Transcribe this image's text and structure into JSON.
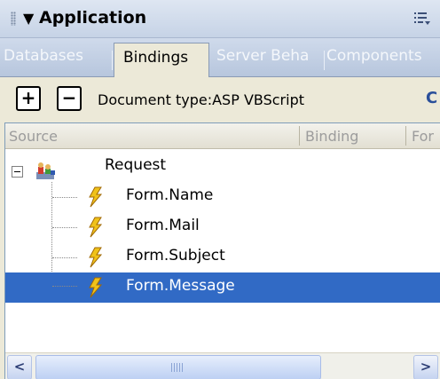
{
  "panel": {
    "title": "Application",
    "collapse_glyph": "▼",
    "options_icon": "panel-options-icon"
  },
  "tabs": [
    {
      "label": "Databases",
      "active": false
    },
    {
      "label": "Bindings",
      "active": true
    },
    {
      "label": "Server Beha",
      "active": false
    },
    {
      "label": "Components",
      "active": false
    }
  ],
  "toolbar": {
    "add_label": "+",
    "remove_label": "−",
    "document_type": "Document type:ASP VBScript",
    "refresh_glyph": "C"
  },
  "table": {
    "columns": [
      "Source",
      "Binding",
      "For"
    ],
    "tree": {
      "root": "Request",
      "children": [
        "Form.Name",
        "Form.Mail",
        "Form.Subject",
        "Form.Message"
      ],
      "selected": "Form.Message"
    }
  },
  "scrollbar": {
    "left_glyph": "<",
    "right_glyph": ">"
  },
  "colors": {
    "selection": "#316ac5",
    "titlebar": "#c6d3e6",
    "panel_bg": "#ece9d8"
  }
}
